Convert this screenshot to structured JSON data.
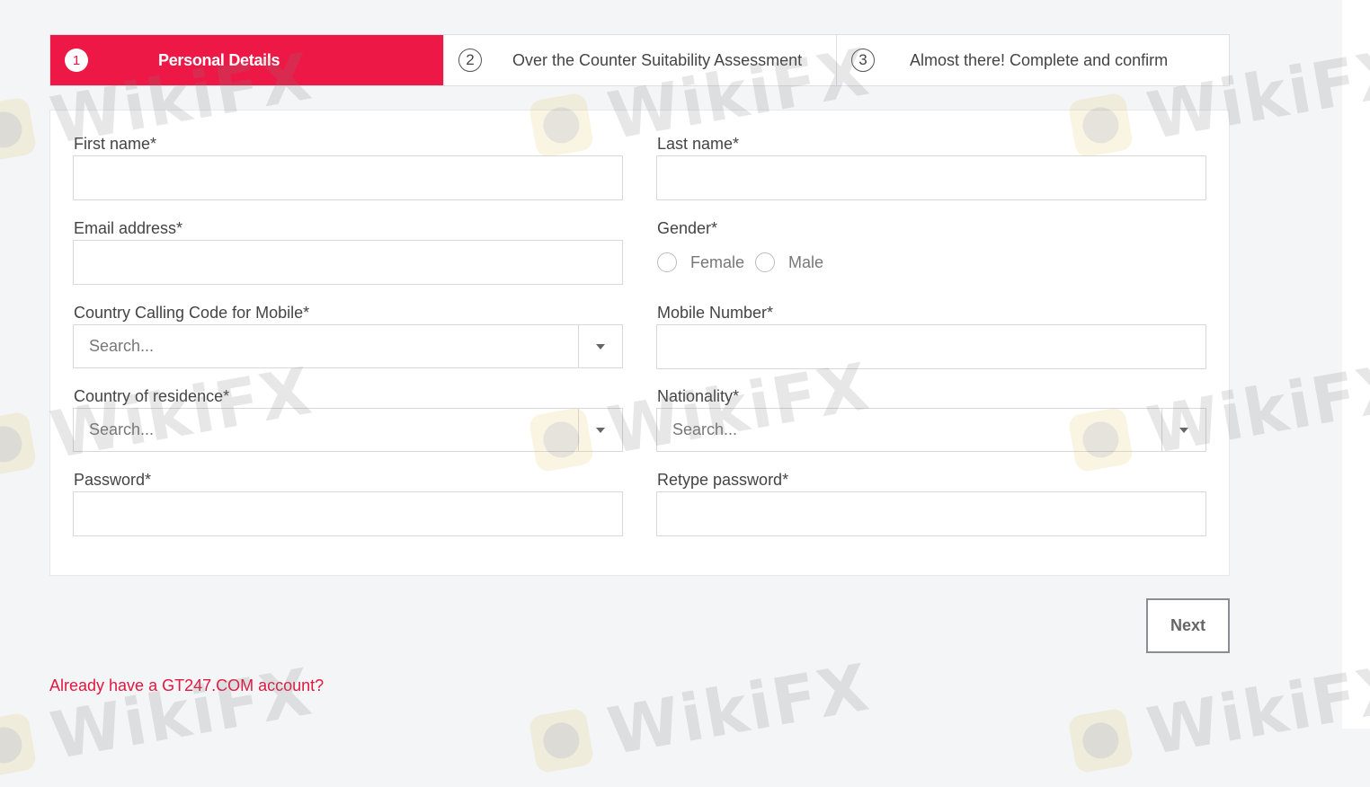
{
  "stepper": {
    "steps": [
      {
        "number": "1",
        "label": "Personal Details",
        "active": true
      },
      {
        "number": "2",
        "label": "Over the Counter Suitability Assessment",
        "active": false
      },
      {
        "number": "3",
        "label": "Almost there! Complete and confirm",
        "active": false
      }
    ]
  },
  "form": {
    "first_name": {
      "label": "First name*",
      "value": ""
    },
    "last_name": {
      "label": "Last name*",
      "value": ""
    },
    "email": {
      "label": "Email address*",
      "value": ""
    },
    "gender": {
      "label": "Gender*",
      "options": [
        "Female",
        "Male"
      ],
      "selected": null
    },
    "calling_code": {
      "label": "Country Calling Code for Mobile*",
      "placeholder": "Search..."
    },
    "mobile_number": {
      "label": "Mobile Number*",
      "value": ""
    },
    "country_residence": {
      "label": "Country of residence*",
      "placeholder": "Search..."
    },
    "nationality": {
      "label": "Nationality*",
      "placeholder": "Search..."
    },
    "password": {
      "label": "Password*",
      "value": ""
    },
    "retype_password": {
      "label": "Retype password*",
      "value": ""
    }
  },
  "actions": {
    "next_label": "Next"
  },
  "footer": {
    "login_link": "Already have a GT247.COM account?"
  },
  "watermark": {
    "text": "WikiFX"
  },
  "colors": {
    "accent": "#ee1846",
    "link": "#e2173f",
    "background": "#f3f5f7"
  }
}
